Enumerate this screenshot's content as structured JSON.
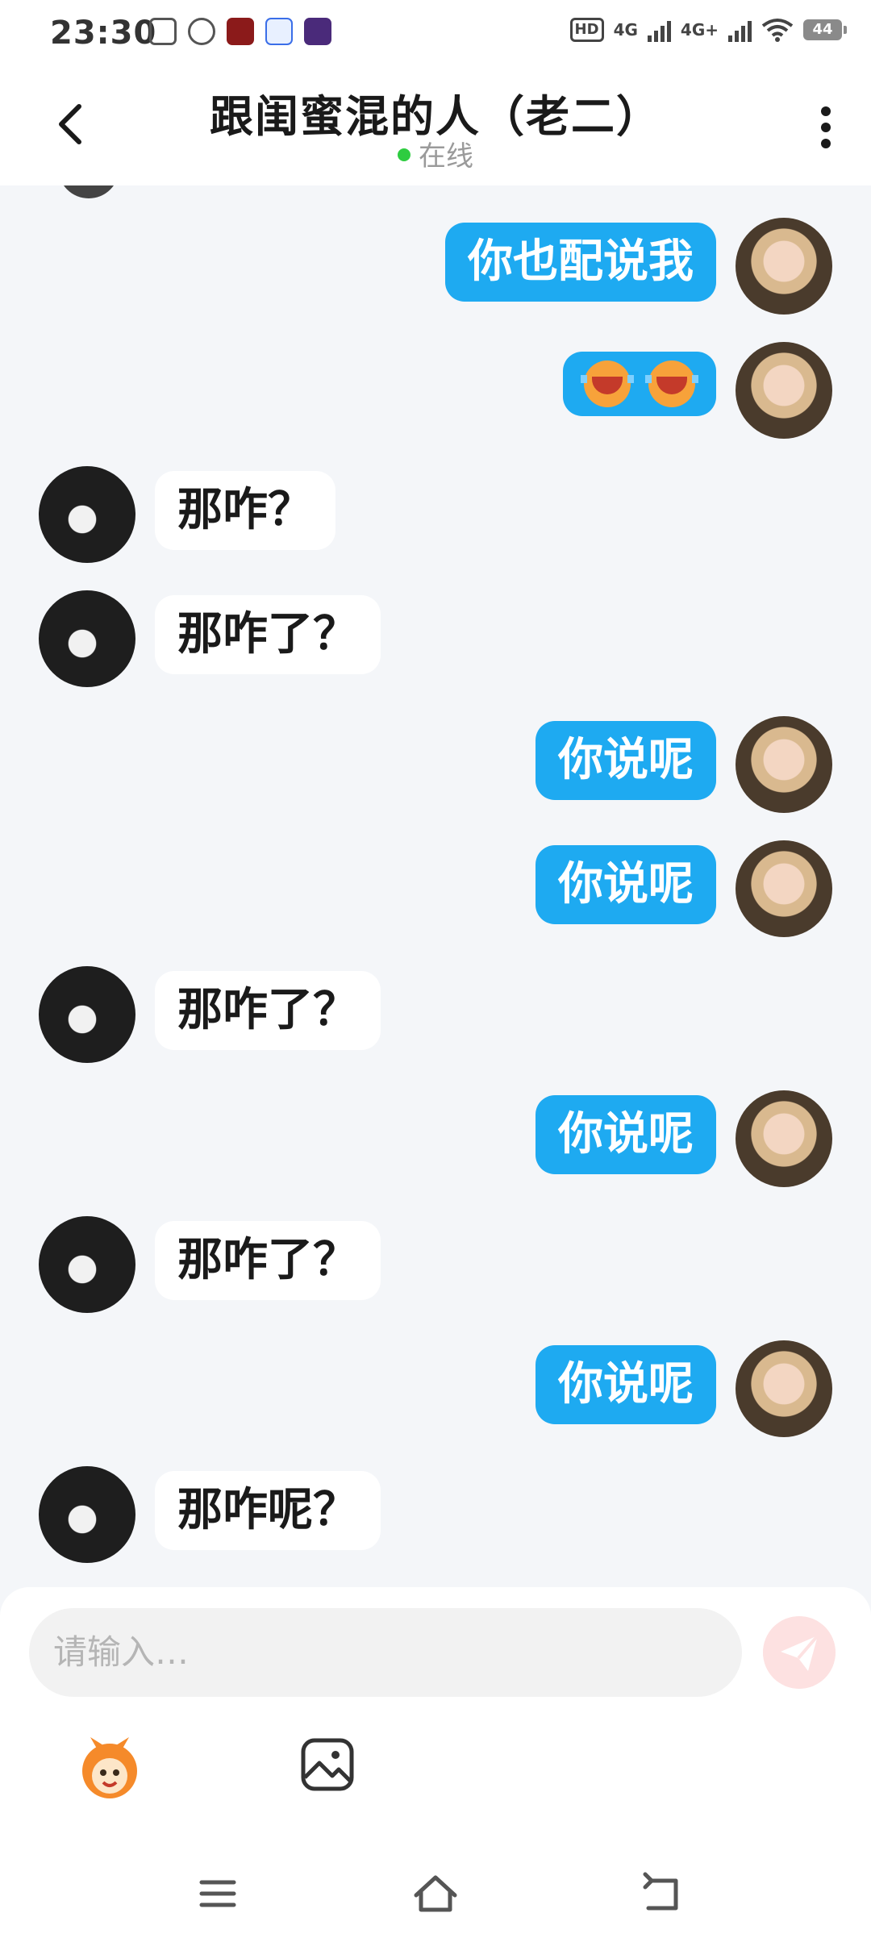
{
  "status_bar": {
    "time": "23:30",
    "hd_label": "HD",
    "net1": "4G",
    "net2": "4G+",
    "battery": "44"
  },
  "header": {
    "title": "跟闺蜜混的人（老二）",
    "status": "在线",
    "online_color": "#2ecc40"
  },
  "colors": {
    "my_bubble": "#1eaaf1",
    "their_bubble": "#ffffff",
    "background": "#f4f6f9"
  },
  "messages": [
    {
      "sender": "me",
      "text": "你也配说我"
    },
    {
      "sender": "me",
      "type": "emoji",
      "emojis": [
        "crying-face-icon",
        "crying-face-icon"
      ]
    },
    {
      "sender": "her",
      "text": "那咋？"
    },
    {
      "sender": "her",
      "text": "那咋了？"
    },
    {
      "sender": "me",
      "text": "你说呢"
    },
    {
      "sender": "me",
      "text": "你说呢"
    },
    {
      "sender": "her",
      "text": "那咋了？"
    },
    {
      "sender": "me",
      "text": "你说呢"
    },
    {
      "sender": "her",
      "text": "那咋了？"
    },
    {
      "sender": "me",
      "text": "你说呢"
    },
    {
      "sender": "her",
      "text": "那咋呢？"
    }
  ],
  "composer": {
    "placeholder": "请输入…"
  }
}
